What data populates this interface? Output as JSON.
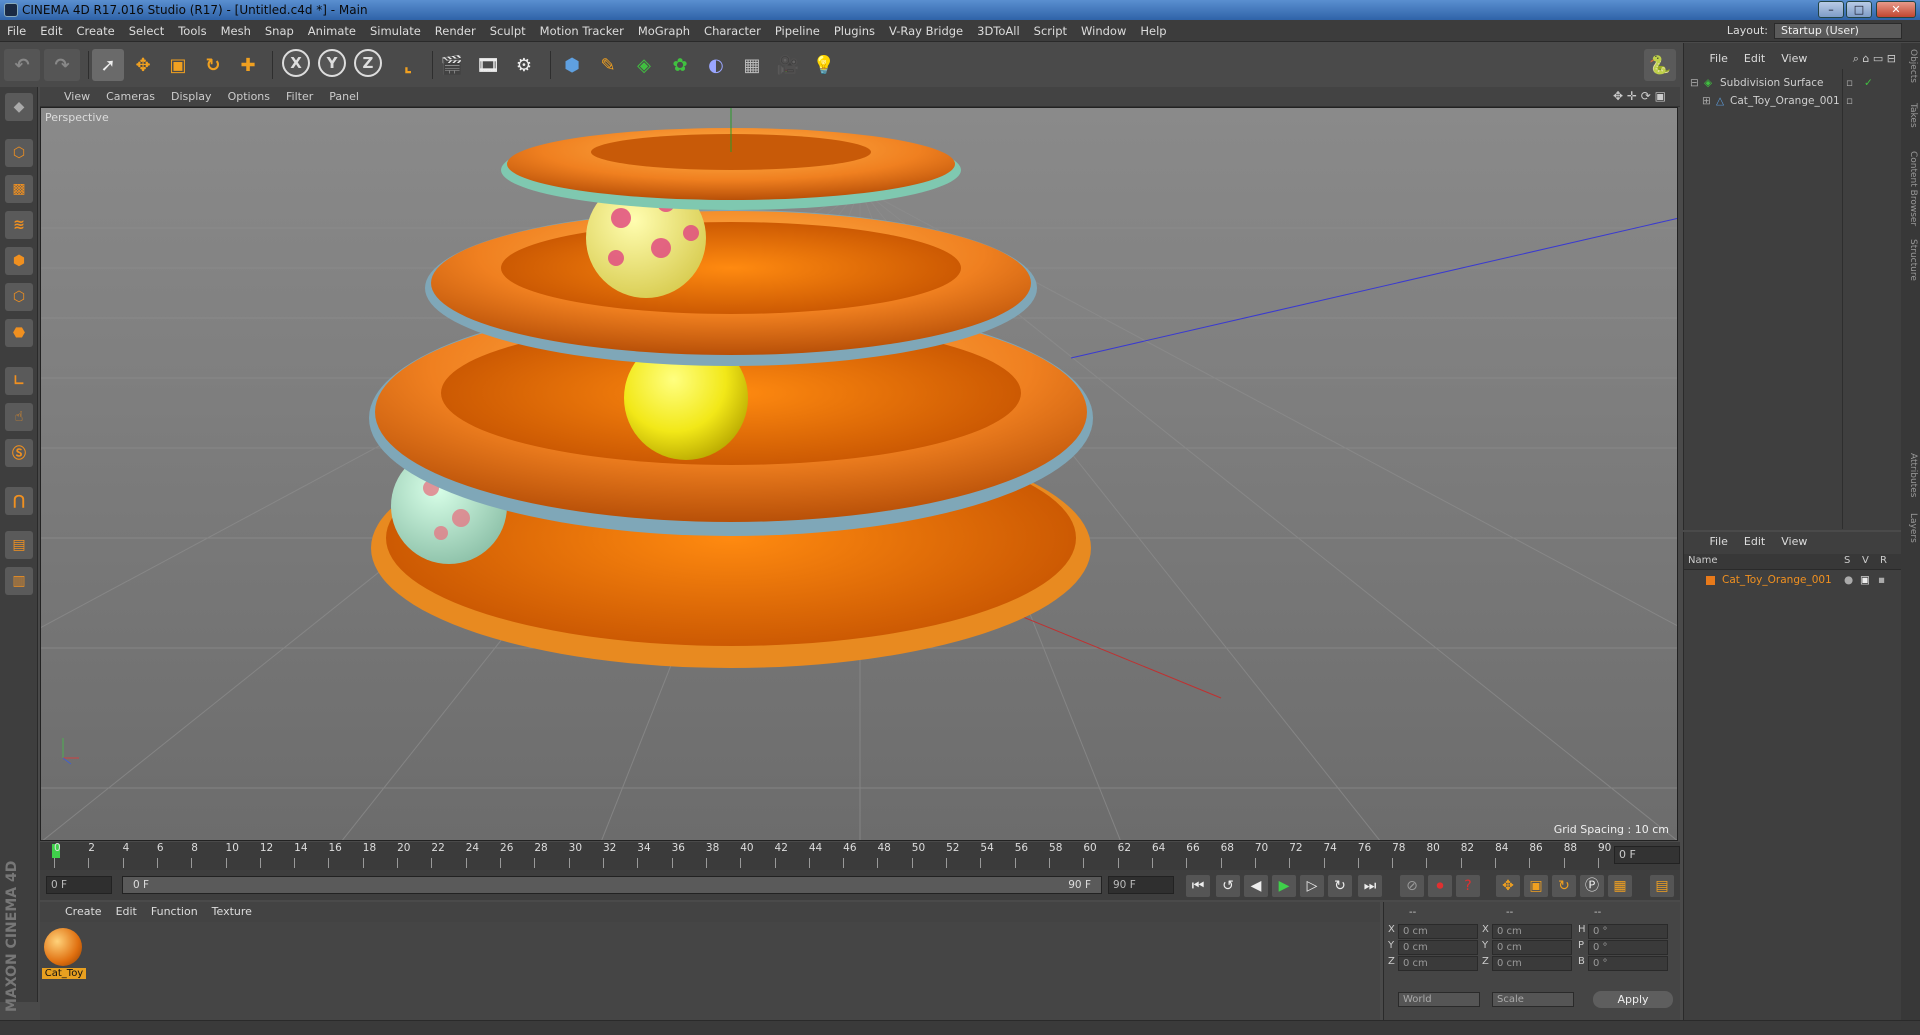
{
  "window": {
    "title": "CINEMA 4D R17.016 Studio (R17) - [Untitled.c4d *] - Main",
    "min": "–",
    "max": "□",
    "close": "✕"
  },
  "menubar": {
    "items": [
      "File",
      "Edit",
      "Create",
      "Select",
      "Tools",
      "Mesh",
      "Snap",
      "Animate",
      "Simulate",
      "Render",
      "Sculpt",
      "Motion Tracker",
      "MoGraph",
      "Character",
      "Pipeline",
      "Plugins",
      "V-Ray Bridge",
      "3DToAll",
      "Script",
      "Window",
      "Help"
    ],
    "layout_label": "Layout:",
    "layout_value": "Startup (User)"
  },
  "toolbar": {
    "axis_x": "X",
    "axis_y": "Y",
    "axis_z": "Z"
  },
  "viewport": {
    "menu": [
      "View",
      "Cameras",
      "Display",
      "Options",
      "Filter",
      "Panel"
    ],
    "label": "Perspective",
    "grid_spacing": "Grid Spacing : 10 cm"
  },
  "timeline": {
    "ticks": [
      "0",
      "2",
      "4",
      "6",
      "8",
      "10",
      "12",
      "14",
      "16",
      "18",
      "20",
      "22",
      "24",
      "26",
      "28",
      "30",
      "32",
      "34",
      "36",
      "38",
      "40",
      "42",
      "44",
      "46",
      "48",
      "50",
      "52",
      "54",
      "56",
      "58",
      "60",
      "62",
      "64",
      "66",
      "68",
      "70",
      "72",
      "74",
      "76",
      "78",
      "80",
      "82",
      "84",
      "86",
      "88",
      "90"
    ],
    "current_frame": "0 F",
    "start": "0 F",
    "range_start": "0 F",
    "range_end": "90 F",
    "end": "90 F"
  },
  "materials": {
    "menu": [
      "Create",
      "Edit",
      "Function",
      "Texture"
    ],
    "items": [
      {
        "name": "Cat_Toy"
      }
    ]
  },
  "coordinates": {
    "header": [
      "--",
      "--",
      "--"
    ],
    "rows": [
      {
        "a": "X",
        "pos": "0 cm",
        "b": "X",
        "size": "0 cm",
        "c": "H",
        "rot": "0 °"
      },
      {
        "a": "Y",
        "pos": "0 cm",
        "b": "Y",
        "size": "0 cm",
        "c": "P",
        "rot": "0 °"
      },
      {
        "a": "Z",
        "pos": "0 cm",
        "b": "Z",
        "size": "0 cm",
        "c": "B",
        "rot": "0 °"
      }
    ],
    "world": "World",
    "scale": "Scale",
    "apply": "Apply"
  },
  "objects": {
    "menu": [
      "File",
      "Edit",
      "View"
    ],
    "items": [
      {
        "name": "Subdivision Surface"
      },
      {
        "name": "Cat_Toy_Orange_001"
      }
    ]
  },
  "layers": {
    "menu": [
      "File",
      "Edit",
      "View"
    ],
    "col_name": "Name",
    "col_s": "S",
    "col_v": "V",
    "col_r": "R",
    "items": [
      {
        "name": "Cat_Toy_Orange_001"
      }
    ]
  },
  "sidetabs": [
    "Objects",
    "Takes",
    "Content Browser",
    "Structure",
    "Attributes",
    "Layers"
  ],
  "branding": "MAXON CINEMA 4D",
  "colors": {
    "accent": "#f09020",
    "object_green": "#40c040",
    "layer_orange": "#e87a1a"
  }
}
